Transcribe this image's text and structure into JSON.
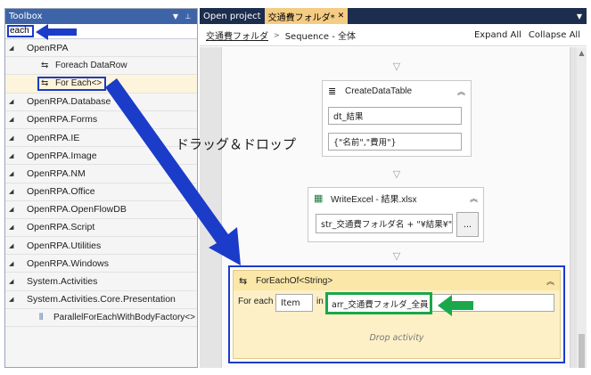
{
  "toolbox": {
    "title": "Toolbox",
    "search_value": "each",
    "categories": [
      {
        "label": "OpenRPA"
      },
      {
        "label": "OpenRPA.Database"
      },
      {
        "label": "OpenRPA.Forms"
      },
      {
        "label": "OpenRPA.IE"
      },
      {
        "label": "OpenRPA.Image"
      },
      {
        "label": "OpenRPA.NM"
      },
      {
        "label": "OpenRPA.Office"
      },
      {
        "label": "OpenRPA.OpenFlowDB"
      },
      {
        "label": "OpenRPA.Script"
      },
      {
        "label": "OpenRPA.Utilities"
      },
      {
        "label": "OpenRPA.Windows"
      },
      {
        "label": "System.Activities"
      },
      {
        "label": "System.Activities.Core.Presentation"
      }
    ],
    "openrpa_children": [
      "Foreach DataRow",
      "For Each<>"
    ],
    "presentation_child": "ParallelForEachWithBodyFactory<>"
  },
  "tabs": [
    {
      "label": "Open project"
    },
    {
      "label": "交通費フォルダ*"
    }
  ],
  "breadcrumb": {
    "link": "交通費フォルダ",
    "current": "Sequence - 全体",
    "expand_all": "Expand All",
    "collapse_all": "Collapse All"
  },
  "activities": {
    "create_data_table": {
      "title": "CreateDataTable",
      "field1": "dt_結果",
      "field2": "{\"名前\",\"費用\"}"
    },
    "write_excel": {
      "title": "WriteExcel - 結果.xlsx",
      "field": "str_交通費フォルダ名 + \"¥結果¥\" +",
      "browse": "..."
    },
    "foreach": {
      "title": "ForEachOf<String>",
      "for_each_label": "For each",
      "item_value": "Item",
      "in_label": "in",
      "collection_value": "arr_交通費フォルダ_全員",
      "drop_hint": "Drop activity"
    }
  },
  "annotation": "ドラッグ＆ドロップ",
  "colors": {
    "arrow_blue": "#1b3bc9",
    "arrow_green": "#1aa84a",
    "tab_bar": "#1c2d4e",
    "toolbox_header": "#3e64a8",
    "active_tab": "#f5cc84"
  }
}
